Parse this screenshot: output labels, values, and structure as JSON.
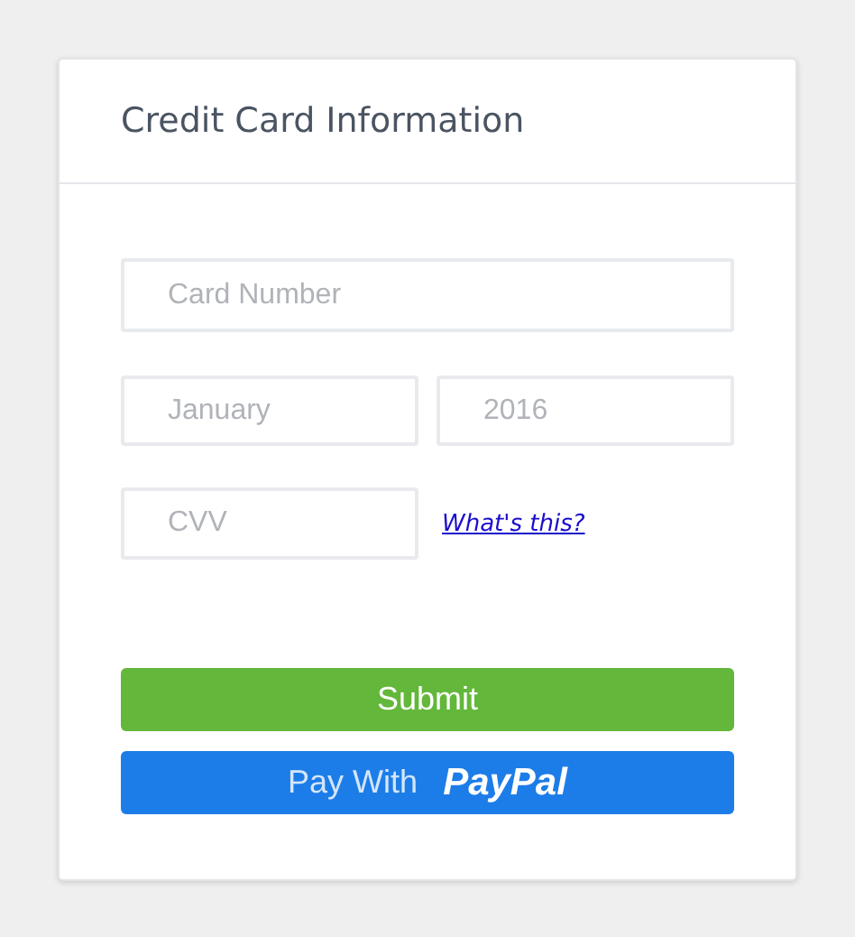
{
  "card": {
    "title": "Credit Card Information"
  },
  "fields": {
    "card_number": {
      "placeholder": "Card Number"
    },
    "month": {
      "placeholder": "January"
    },
    "year": {
      "placeholder": "2016"
    },
    "cvv": {
      "placeholder": "CVV"
    }
  },
  "help_link": "What's this?",
  "buttons": {
    "submit": "Submit",
    "paypal": {
      "prefix": "Pay With",
      "brand": "PayPal"
    }
  }
}
